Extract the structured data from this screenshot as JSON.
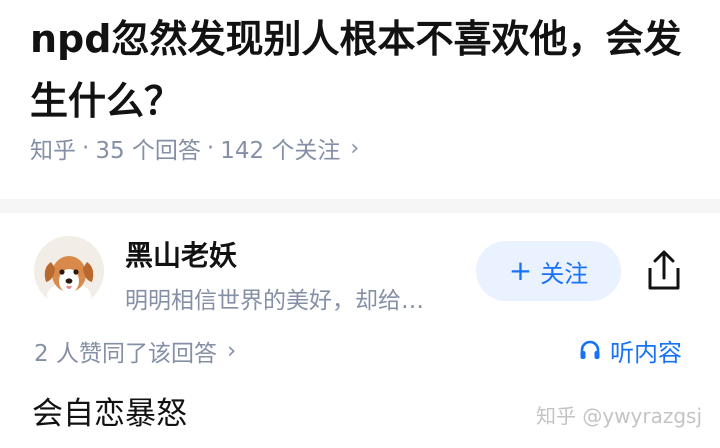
{
  "question": {
    "title": "npd忽然发现别人根本不喜欢他，会发生什么？"
  },
  "meta": {
    "source": "知乎",
    "separator": "·",
    "answers": "35 个回答",
    "followers": "142 个关注",
    "chevron": "›"
  },
  "author": {
    "name": "黑山老妖",
    "bio": "明明相信世界的美好，却给…",
    "avatar_icon": "dog-avatar"
  },
  "actions": {
    "follow_label": "关注",
    "follow_plus": "+",
    "share_icon": "share-icon",
    "listen_label": "听内容",
    "listen_icon": "headphones-icon"
  },
  "upvotes": {
    "text": "2 人赞同了该回答",
    "chevron": "›"
  },
  "answer": {
    "text": "会自恋暴怒"
  },
  "watermark": "知乎 @ywyrazgsj",
  "colors": {
    "accent": "#1772f6",
    "follow_bg": "#eaf2ff",
    "muted": "#8590a6",
    "text": "#121212",
    "divider": "#f6f6f6"
  }
}
